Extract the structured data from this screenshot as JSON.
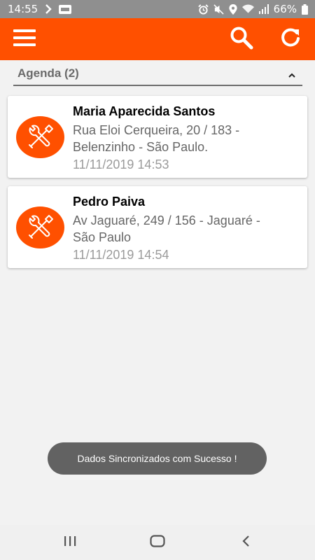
{
  "status_bar": {
    "time": "14:55",
    "battery_percent": "66%",
    "icons": [
      "chevron-right-icon",
      "notification-badge-icon",
      "alarm-icon",
      "mute-icon",
      "location-icon",
      "wifi-icon",
      "signal-icon",
      "battery-icon"
    ]
  },
  "toolbar": {
    "background": "#ff5000",
    "icons": [
      "menu-icon",
      "search-icon",
      "refresh-icon"
    ]
  },
  "section": {
    "title": "Agenda (2)",
    "icon": "chevron-up-icon"
  },
  "appointments": [
    {
      "name": "Maria Aparecida Santos",
      "address_line1": "Rua Eloi Cerqueira, 20 / 183 -",
      "address_line2": "Belenzinho - São Paulo.",
      "datetime": "11/11/2019 14:53",
      "icon": "tools-icon"
    },
    {
      "name": "Pedro Paiva",
      "address_line1": "Av Jaguaré, 249 / 156 - Jaguaré -",
      "address_line2": "São Paulo",
      "datetime": "11/11/2019 14:54",
      "icon": "tools-icon"
    }
  ],
  "toast": {
    "message": "Dados Sincronizados com Sucesso !"
  },
  "nav_bar": {
    "icons": [
      "recent-apps-icon",
      "home-icon",
      "back-icon"
    ]
  }
}
